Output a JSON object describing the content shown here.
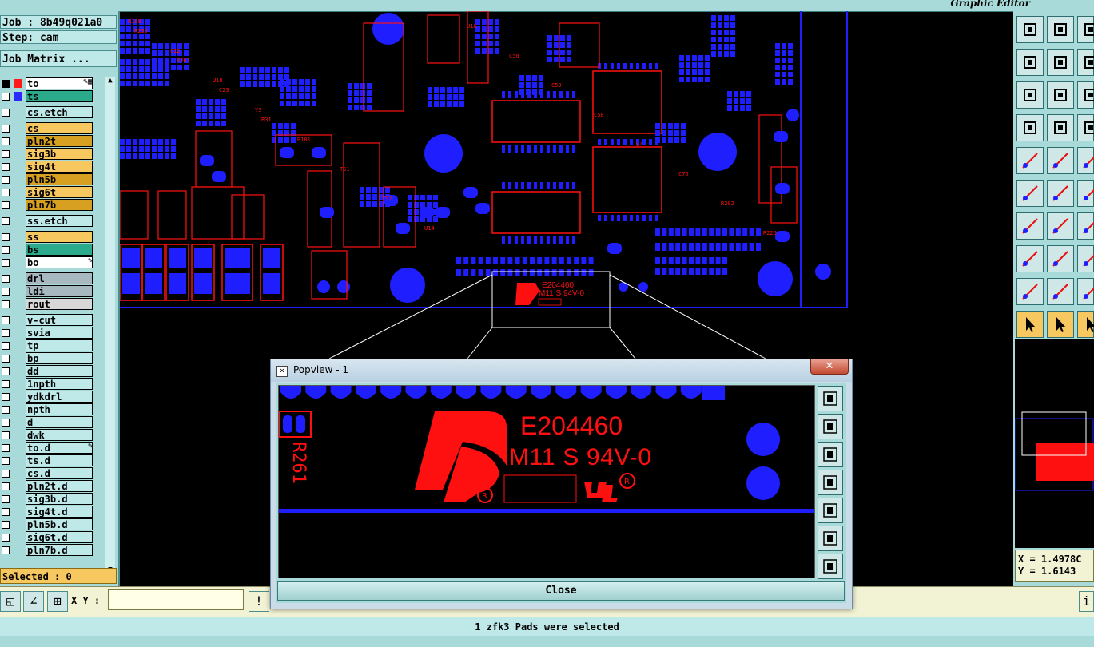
{
  "header": {
    "app_title": "Graphic Editor"
  },
  "job": {
    "job_label": "Job : 8b49q021a0",
    "step_label": "Step: cam",
    "matrix_button": "Job Matrix ..."
  },
  "layers": [
    {
      "name": "to",
      "color": "#ffffff",
      "swatch": "#ff1a1a",
      "mark": "✎▦",
      "active": true
    },
    {
      "name": "ts",
      "color": "#2bab8b",
      "swatch": "#2a2aff",
      "mark": ""
    },
    {
      "name": "cs.etch",
      "color": "#bfe8e8",
      "swatch": "",
      "mark": ""
    },
    {
      "name": "cs",
      "color": "#f8c860",
      "swatch": "",
      "mark": ""
    },
    {
      "name": "pln2t",
      "color": "#d8a020",
      "swatch": "",
      "mark": ""
    },
    {
      "name": "sig3b",
      "color": "#f8c860",
      "swatch": "",
      "mark": ""
    },
    {
      "name": "sig4t",
      "color": "#f8c860",
      "swatch": "",
      "mark": ""
    },
    {
      "name": "pln5b",
      "color": "#d8a020",
      "swatch": "",
      "mark": ""
    },
    {
      "name": "sig6t",
      "color": "#f8c860",
      "swatch": "",
      "mark": ""
    },
    {
      "name": "pln7b",
      "color": "#d8a020",
      "swatch": "",
      "mark": ""
    },
    {
      "name": "ss.etch",
      "color": "#bfe8e8",
      "swatch": "",
      "mark": ""
    },
    {
      "name": "ss",
      "color": "#f8c860",
      "swatch": "",
      "mark": ""
    },
    {
      "name": "bs",
      "color": "#2bab8b",
      "swatch": "",
      "mark": ""
    },
    {
      "name": "bo",
      "color": "#ffffff",
      "swatch": "",
      "mark": "✎"
    },
    {
      "name": "drl",
      "color": "#a8b8c0",
      "swatch": "",
      "mark": ""
    },
    {
      "name": "ldi",
      "color": "#a8b8c0",
      "swatch": "",
      "mark": ""
    },
    {
      "name": "rout",
      "color": "#d8d8d8",
      "swatch": "",
      "mark": ""
    },
    {
      "name": "v-cut",
      "color": "#bfe8e8",
      "swatch": "",
      "mark": ""
    },
    {
      "name": "svia",
      "color": "#bfe8e8",
      "swatch": "",
      "mark": ""
    },
    {
      "name": "tp",
      "color": "#bfe8e8",
      "swatch": "",
      "mark": ""
    },
    {
      "name": "bp",
      "color": "#bfe8e8",
      "swatch": "",
      "mark": ""
    },
    {
      "name": "dd",
      "color": "#bfe8e8",
      "swatch": "",
      "mark": ""
    },
    {
      "name": "1npth",
      "color": "#bfe8e8",
      "swatch": "",
      "mark": ""
    },
    {
      "name": "ydkdrl",
      "color": "#bfe8e8",
      "swatch": "",
      "mark": ""
    },
    {
      "name": "npth",
      "color": "#bfe8e8",
      "swatch": "",
      "mark": ""
    },
    {
      "name": "d",
      "color": "#bfe8e8",
      "swatch": "",
      "mark": ""
    },
    {
      "name": "dwk",
      "color": "#bfe8e8",
      "swatch": "",
      "mark": ""
    },
    {
      "name": "to.d",
      "color": "#bfe8e8",
      "swatch": "",
      "mark": "✎"
    },
    {
      "name": "ts.d",
      "color": "#bfe8e8",
      "swatch": "",
      "mark": ""
    },
    {
      "name": "cs.d",
      "color": "#bfe8e8",
      "swatch": "",
      "mark": ""
    },
    {
      "name": "pln2t.d",
      "color": "#bfe8e8",
      "swatch": "",
      "mark": ""
    },
    {
      "name": "sig3b.d",
      "color": "#bfe8e8",
      "swatch": "",
      "mark": ""
    },
    {
      "name": "sig4t.d",
      "color": "#bfe8e8",
      "swatch": "",
      "mark": ""
    },
    {
      "name": "pln5b.d",
      "color": "#bfe8e8",
      "swatch": "",
      "mark": ""
    },
    {
      "name": "sig6t.d",
      "color": "#bfe8e8",
      "swatch": "",
      "mark": ""
    },
    {
      "name": "pln7b.d",
      "color": "#bfe8e8",
      "swatch": "",
      "mark": ""
    }
  ],
  "selection": {
    "label": "Selected : 0"
  },
  "xy": {
    "label": "X Y :",
    "value": ""
  },
  "status": {
    "message": "1 zfk3 Pads were selected"
  },
  "coords": {
    "x": "X = 1.4978C",
    "y": "Y = 1.6143"
  },
  "popview": {
    "title": "Popview - 1",
    "close_label": "Close",
    "marking_line1": "E204460",
    "marking_line2": "M11 S 94V-0",
    "refdes": "R261"
  },
  "board_text": {
    "marking_line1": "E204460",
    "marking_line2": "M11 S 94V-0"
  },
  "colors": {
    "copper": "#1e1eff",
    "silkscreen": "#ff1010",
    "panel": "#a8dada"
  },
  "icons": [
    "zoom-in-icon",
    "zoom-out-icon",
    "measure-icon",
    "grid-icon",
    "snap-icon"
  ]
}
